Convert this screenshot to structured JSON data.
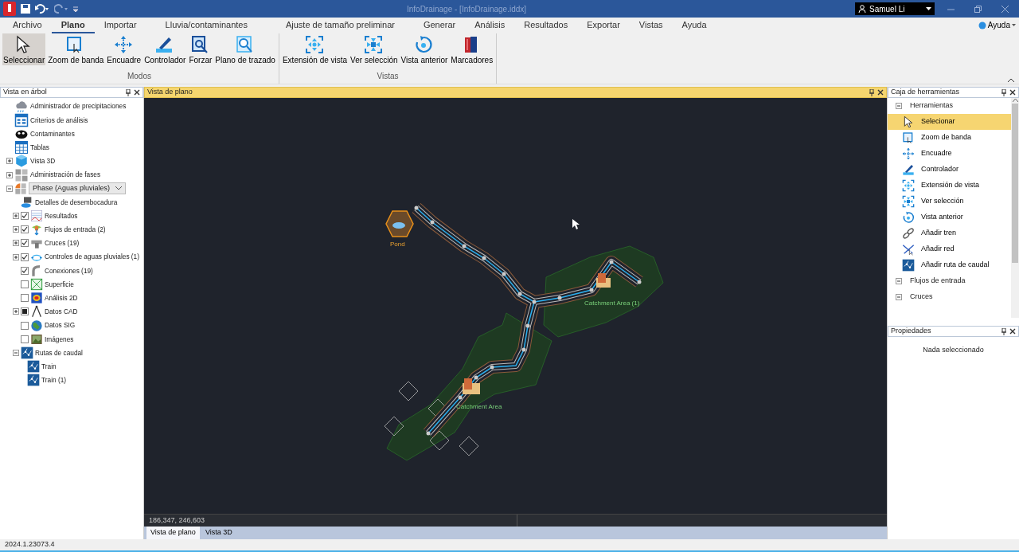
{
  "window": {
    "title": "InfoDrainage - [InfoDrainage.iddx]",
    "user": "Samuel Li"
  },
  "ribbon": {
    "tabs": [
      {
        "label": "Archivo",
        "selected": false
      },
      {
        "label": "Plano",
        "selected": true
      },
      {
        "label": "Importar",
        "selected": false
      },
      {
        "label": "Lluvia/contaminantes",
        "selected": false
      },
      {
        "label": "Ajuste de tamaño preliminar",
        "selected": false
      },
      {
        "label": "Generar",
        "selected": false
      },
      {
        "label": "Análisis",
        "selected": false
      },
      {
        "label": "Resultados",
        "selected": false
      },
      {
        "label": "Exportar",
        "selected": false
      },
      {
        "label": "Vistas",
        "selected": false
      },
      {
        "label": "Ayuda",
        "selected": false
      }
    ],
    "help": "Ayuda",
    "groups": [
      {
        "label": "Modos",
        "buttons": [
          {
            "label": "Seleccionar",
            "selected": true
          },
          {
            "label": "Zoom de banda",
            "selected": false
          },
          {
            "label": "Encuadre",
            "selected": false
          },
          {
            "label": "Controlador",
            "selected": false
          },
          {
            "label": "Forzar",
            "selected": false
          },
          {
            "label": "Plano de trazado",
            "selected": false
          }
        ]
      },
      {
        "label": "Vistas",
        "buttons": [
          {
            "label": "Extensión de vista",
            "selected": false
          },
          {
            "label": "Ver selección",
            "selected": false
          },
          {
            "label": "Vista anterior",
            "selected": false
          },
          {
            "label": "Marcadores",
            "selected": false
          }
        ]
      }
    ]
  },
  "tree_panel": {
    "title": "Vista en árbol",
    "items": [
      {
        "kind": "node",
        "label": "Administrador de precipitaciones"
      },
      {
        "kind": "node",
        "label": "Criterios de análisis"
      },
      {
        "kind": "node",
        "label": "Contaminantes"
      },
      {
        "kind": "node",
        "label": "Tablas"
      },
      {
        "kind": "node",
        "label": "Vista 3D",
        "expanded": false
      },
      {
        "kind": "node",
        "label": "Administración de fases",
        "expanded": false
      },
      {
        "kind": "dropdown",
        "label": "Phase (Aguas pluviales)",
        "expanded": true,
        "children": [
          {
            "kind": "node",
            "label": "Detalles de desembocadura"
          },
          {
            "kind": "node",
            "label": "Resultados",
            "expanded": false,
            "checked": true
          },
          {
            "kind": "node",
            "label": "Flujos de entrada (2)",
            "expanded": false,
            "checked": true
          },
          {
            "kind": "node",
            "label": "Cruces (19)",
            "expanded": false,
            "checked": true
          },
          {
            "kind": "node",
            "label": "Controles de aguas pluviales (1)",
            "expanded": false,
            "checked": true
          },
          {
            "kind": "node",
            "label": "Conexiones (19)",
            "checked": true
          },
          {
            "kind": "node",
            "label": "Superficie",
            "checked": false
          },
          {
            "kind": "node",
            "label": "Análisis 2D",
            "checked": false
          },
          {
            "kind": "node",
            "label": "Datos CAD",
            "expanded": false,
            "checked": true,
            "indeterminate": true
          },
          {
            "kind": "node",
            "label": "Datos SIG",
            "checked": false
          },
          {
            "kind": "node",
            "label": "Imágenes",
            "checked": false
          },
          {
            "kind": "node",
            "label": "Rutas de caudal",
            "expanded": true,
            "children": [
              {
                "kind": "node",
                "label": "Train"
              },
              {
                "kind": "node",
                "label": "Train (1)"
              }
            ]
          }
        ]
      }
    ]
  },
  "plan_view": {
    "title": "Vista de plano",
    "map_labels": [
      "Pond",
      "Catchment Area (1)",
      "Catchment Area"
    ],
    "coordinates": "186,347, 246,603",
    "tabs": [
      {
        "label": "Vista de plano",
        "selected": true
      },
      {
        "label": "Vista 3D",
        "selected": false
      }
    ]
  },
  "toolbox": {
    "title": "Caja de herramientas",
    "groups": [
      {
        "label": "Herramientas",
        "expanded": true,
        "items": [
          {
            "label": "Selecionar",
            "selected": true
          },
          {
            "label": "Zoom de banda",
            "selected": false
          },
          {
            "label": "Encuadre",
            "selected": false
          },
          {
            "label": "Controlador",
            "selected": false
          },
          {
            "label": "Extensión de vista",
            "selected": false
          },
          {
            "label": "Ver selección",
            "selected": false
          },
          {
            "label": "Vista anterior",
            "selected": false
          },
          {
            "label": "Añadir tren",
            "selected": false
          },
          {
            "label": "Añadir red",
            "selected": false
          },
          {
            "label": "Añadir ruta de caudal",
            "selected": false
          }
        ]
      },
      {
        "label": "Flujos de entrada",
        "expanded": true
      },
      {
        "label": "Cruces",
        "expanded": true
      }
    ]
  },
  "properties": {
    "title": "Propiedades",
    "message": "Nada seleccionado"
  },
  "status_bar": {
    "version": "2024.1.23073.4"
  }
}
